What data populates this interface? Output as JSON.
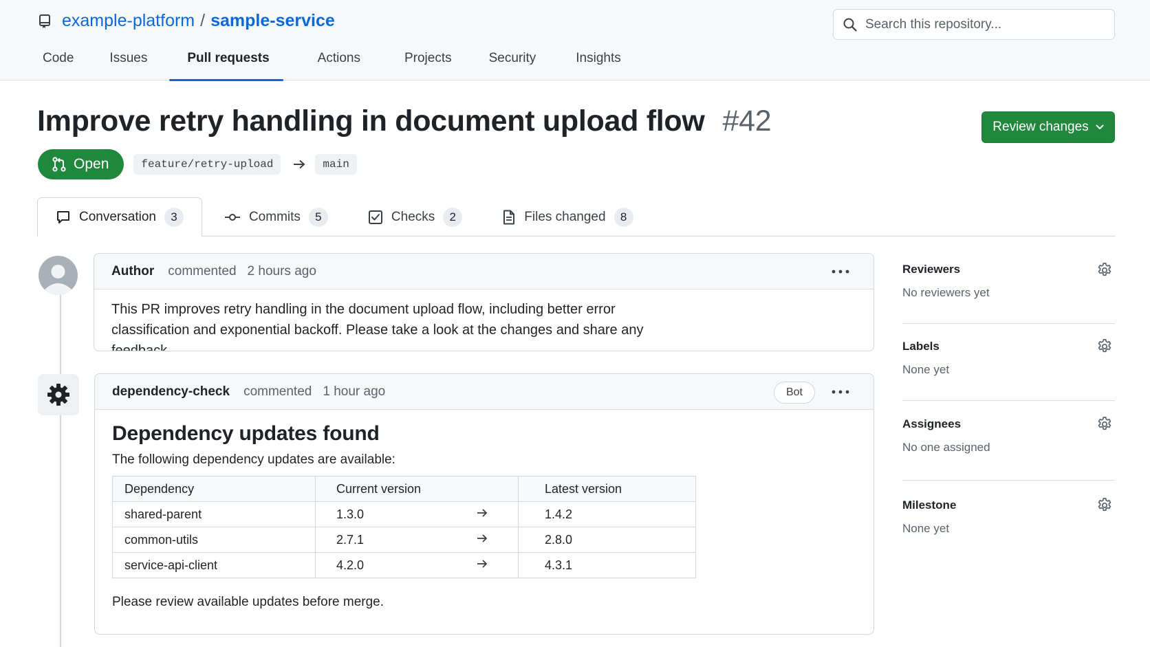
{
  "repo": {
    "owner": "example-platform",
    "separator": "/",
    "name": "sample-service"
  },
  "search": {
    "placeholder": "Search this repository..."
  },
  "nav": {
    "tabs": [
      "Code",
      "Issues",
      "Pull requests",
      "Actions",
      "Projects",
      "Security",
      "Insights"
    ],
    "active": "Pull requests"
  },
  "pr": {
    "title": "Improve retry handling in document upload flow",
    "number": "#42",
    "state": "Open",
    "head_branch": "feature/retry-upload",
    "base_branch": "main",
    "review_button": "Review changes"
  },
  "pr_tabs": [
    {
      "label": "Conversation",
      "count": "3",
      "icon": "comment-icon"
    },
    {
      "label": "Commits",
      "count": "5",
      "icon": "commit-icon"
    },
    {
      "label": "Checks",
      "count": "2",
      "icon": "checklist-icon"
    },
    {
      "label": "Files changed",
      "count": "8",
      "icon": "file-icon"
    }
  ],
  "comments": [
    {
      "author": "Author",
      "action": "commented",
      "time": "2 hours ago",
      "body": "This PR improves retry handling in the document upload flow, including better error classification and exponential backoff. Please take a look at the changes and share any feedback."
    },
    {
      "author": "dependency-check",
      "action": "commented",
      "time": "1 hour ago",
      "badge": "Bot",
      "heading": "Dependency updates found",
      "intro": "The following dependency updates are available:",
      "table": {
        "headers": [
          "Dependency",
          "Current version",
          "Latest version"
        ],
        "rows": [
          [
            "shared-parent",
            "1.3.0",
            "1.4.2"
          ],
          [
            "common-utils",
            "2.7.1",
            "2.8.0"
          ],
          [
            "service-api-client",
            "4.2.0",
            "4.3.1"
          ]
        ]
      },
      "outro": "Please review available updates before merge."
    }
  ],
  "sidebar": [
    {
      "title": "Reviewers",
      "value": "No reviewers yet"
    },
    {
      "title": "Labels",
      "value": "None yet"
    },
    {
      "title": "Assignees",
      "value": "No one assigned"
    },
    {
      "title": "Milestone",
      "value": "None yet"
    }
  ],
  "colors": {
    "accent": "#0969da",
    "open_green": "#1f883d",
    "border": "#d0d7de",
    "muted_text": "#59636e"
  }
}
